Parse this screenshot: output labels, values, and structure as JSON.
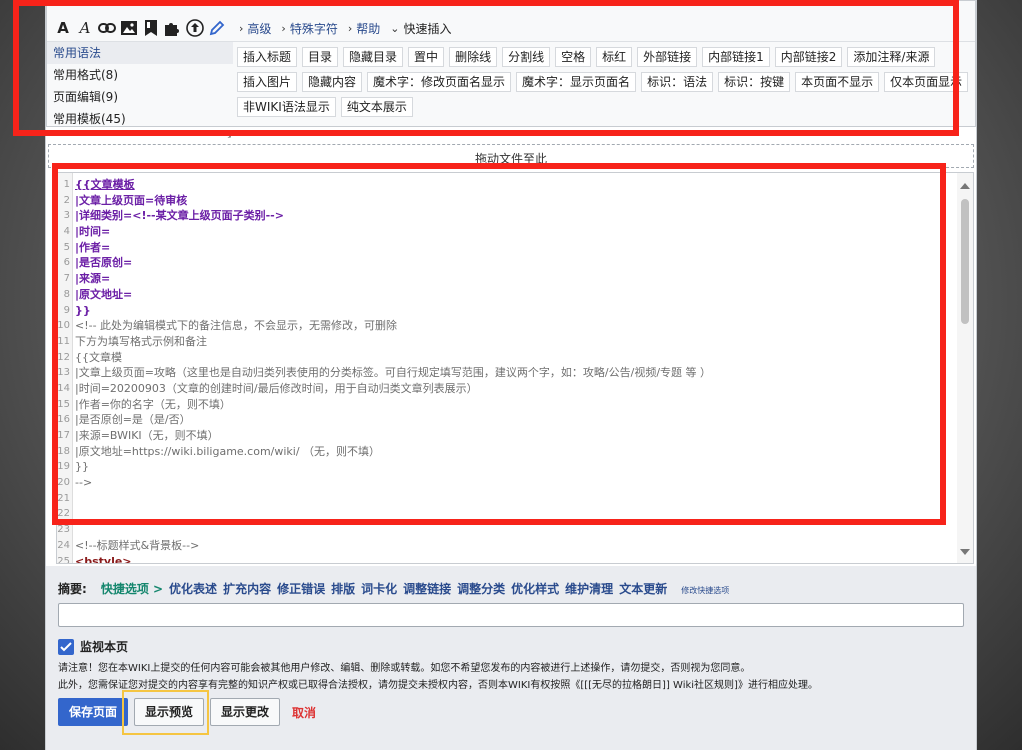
{
  "toolbar": {
    "icons": [
      "bold-icon",
      "italic-icon",
      "link-icon",
      "image-icon",
      "bookmark-icon",
      "puzzle-icon",
      "upload-icon",
      "pencil-icon"
    ],
    "bold_glyph": "A",
    "italic_glyph": "A",
    "menus": [
      {
        "label": "高级",
        "arrow": "›"
      },
      {
        "label": "特殊字符",
        "arrow": "›"
      },
      {
        "label": "帮助",
        "arrow": "›"
      },
      {
        "label": "快速插入",
        "arrow": "⌄"
      }
    ]
  },
  "sidebar": {
    "items": [
      {
        "label": "常用语法",
        "active": true
      },
      {
        "label": "常用格式(8)"
      },
      {
        "label": "页面编辑(9)"
      },
      {
        "label": "常用模板(45)"
      }
    ]
  },
  "snippets": {
    "row1": [
      "插入标题",
      "目录",
      "隐藏目录",
      "置中",
      "删除线",
      "分割线",
      "空格",
      "标红",
      "外部链接",
      "内部链接1",
      "内部链接2",
      "添加注释/来源"
    ],
    "row2": [
      "插入图片",
      "隐藏内容",
      "魔术字：修改页面名显示",
      "魔术字：显示页面名",
      "标识：语法",
      "标识：按键",
      "本页面不显示",
      "仅本页面显示"
    ],
    "row3": [
      "非WIKI语法显示",
      "纯文本展示"
    ]
  },
  "dropzone": {
    "label": "拖动文件至此"
  },
  "editor": {
    "lines": [
      {
        "n": "1",
        "text": "{{文章模板"
      },
      {
        "n": "2",
        "text": "|文章上级页面=待审核"
      },
      {
        "n": "3",
        "text": "|详细类别=<!--某文章上级页面子类别-->"
      },
      {
        "n": "4",
        "text": "|时间="
      },
      {
        "n": "5",
        "text": "|作者="
      },
      {
        "n": "6",
        "text": "|是否原创="
      },
      {
        "n": "7",
        "text": "|来源="
      },
      {
        "n": "8",
        "text": "|原文地址="
      },
      {
        "n": "9",
        "text": "}}"
      },
      {
        "n": "10",
        "text": "<!-- 此处为编辑模式下的备注信息，不会显示，无需修改，可删除"
      },
      {
        "n": "11",
        "text": "下方为填写格式示例和备注"
      },
      {
        "n": "12",
        "text": "{{文章模"
      },
      {
        "n": "13",
        "text": "|文章上级页面=攻略（这里也是自动归类列表使用的分类标签。可自行规定填写范围，建议两个字，如：攻略/公告/视频/专题 等 ）"
      },
      {
        "n": "14",
        "text": "|时间=20200903（文章的创建时间/最后修改时间，用于自动归类文章列表展示）"
      },
      {
        "n": "15",
        "text": "|作者=你的名字（无，则不填）"
      },
      {
        "n": "16",
        "text": "|是否原创=是（是/否）"
      },
      {
        "n": "17",
        "text": "|来源=BWIKI（无，则不填）"
      },
      {
        "n": "18",
        "text": "|原文地址=https://wiki.biligame.com/wiki/ （无，则不填）"
      },
      {
        "n": "19",
        "text": "}}"
      },
      {
        "n": "20",
        "text": "-->"
      },
      {
        "n": "21",
        "text": ""
      },
      {
        "n": "22",
        "text": ""
      },
      {
        "n": "23",
        "text": ""
      },
      {
        "n": "24",
        "text": "<!--标题样式&背景板-->"
      },
      {
        "n": "25",
        "text": "<bstyle>"
      }
    ]
  },
  "summary": {
    "label": "摘要:",
    "quick_label": "快捷选项 >",
    "options": [
      "优化表述",
      "扩充内容",
      "修正错误",
      "排版",
      "词卡化",
      "调整链接",
      "调整分类",
      "优化样式",
      "维护清理",
      "文本更新"
    ],
    "edit_quick": "修改快捷选项",
    "input_value": ""
  },
  "watch": {
    "label": "监视本页",
    "checked": true
  },
  "notice": {
    "line1": "请注意！您在本WIKI上提交的任何内容可能会被其他用户修改、编辑、删除或转载。如您不希望您发布的内容被进行上述操作，请勿提交，否则视为您同意。",
    "line2": "此外，您需保证您对提交的内容享有完整的知识产权或已取得合法授权，请勿提交未授权内容，否则本WIKI有权按照《[[[无尽的拉格朗日]] Wiki社区规则]》进行相应处理。"
  },
  "actions": {
    "save": "保存页面",
    "preview": "显示预览",
    "diff": "显示更改",
    "cancel": "取消"
  },
  "colors": {
    "highlight_red": "#f7231a",
    "highlight_yellow": "#f5c542",
    "accent": "#3366cc"
  }
}
